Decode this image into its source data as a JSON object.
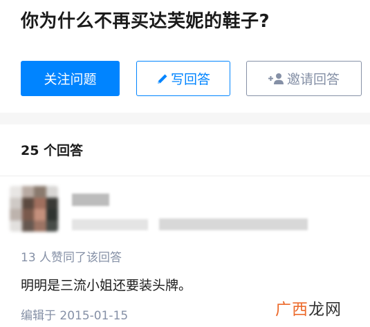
{
  "question": {
    "title": "你为什么不再买达芙妮的鞋子?",
    "follow_label": "关注问题",
    "write_label": "写回答",
    "invite_label": "邀请回答"
  },
  "answers": {
    "count_label": "25 个回答",
    "items": [
      {
        "vote_text": "13 人赞同了该回答",
        "content": "明明是三流小姐还要装头牌。",
        "edit_info": "编辑于 2015-01-15"
      }
    ]
  },
  "watermark": {
    "part1": "广西",
    "part2": "龙网"
  },
  "colors": {
    "accent": "#0084ff",
    "muted": "#8590a6",
    "watermark_orange": "#ec6a2b"
  },
  "icons": {
    "write": "pencil-icon",
    "invite": "add-person-icon"
  }
}
